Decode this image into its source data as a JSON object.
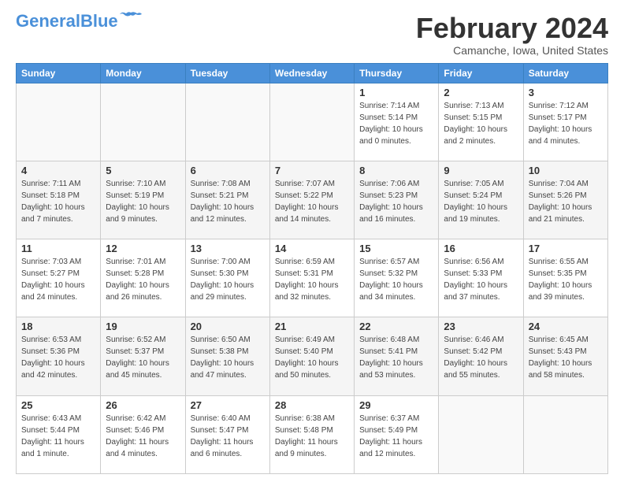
{
  "header": {
    "logo_general": "General",
    "logo_blue": "Blue",
    "month_title": "February 2024",
    "location": "Camanche, Iowa, United States"
  },
  "days_of_week": [
    "Sunday",
    "Monday",
    "Tuesday",
    "Wednesday",
    "Thursday",
    "Friday",
    "Saturday"
  ],
  "weeks": [
    {
      "shaded": false,
      "days": [
        {
          "num": "",
          "info": ""
        },
        {
          "num": "",
          "info": ""
        },
        {
          "num": "",
          "info": ""
        },
        {
          "num": "",
          "info": ""
        },
        {
          "num": "1",
          "info": "Sunrise: 7:14 AM\nSunset: 5:14 PM\nDaylight: 10 hours\nand 0 minutes."
        },
        {
          "num": "2",
          "info": "Sunrise: 7:13 AM\nSunset: 5:15 PM\nDaylight: 10 hours\nand 2 minutes."
        },
        {
          "num": "3",
          "info": "Sunrise: 7:12 AM\nSunset: 5:17 PM\nDaylight: 10 hours\nand 4 minutes."
        }
      ]
    },
    {
      "shaded": true,
      "days": [
        {
          "num": "4",
          "info": "Sunrise: 7:11 AM\nSunset: 5:18 PM\nDaylight: 10 hours\nand 7 minutes."
        },
        {
          "num": "5",
          "info": "Sunrise: 7:10 AM\nSunset: 5:19 PM\nDaylight: 10 hours\nand 9 minutes."
        },
        {
          "num": "6",
          "info": "Sunrise: 7:08 AM\nSunset: 5:21 PM\nDaylight: 10 hours\nand 12 minutes."
        },
        {
          "num": "7",
          "info": "Sunrise: 7:07 AM\nSunset: 5:22 PM\nDaylight: 10 hours\nand 14 minutes."
        },
        {
          "num": "8",
          "info": "Sunrise: 7:06 AM\nSunset: 5:23 PM\nDaylight: 10 hours\nand 16 minutes."
        },
        {
          "num": "9",
          "info": "Sunrise: 7:05 AM\nSunset: 5:24 PM\nDaylight: 10 hours\nand 19 minutes."
        },
        {
          "num": "10",
          "info": "Sunrise: 7:04 AM\nSunset: 5:26 PM\nDaylight: 10 hours\nand 21 minutes."
        }
      ]
    },
    {
      "shaded": false,
      "days": [
        {
          "num": "11",
          "info": "Sunrise: 7:03 AM\nSunset: 5:27 PM\nDaylight: 10 hours\nand 24 minutes."
        },
        {
          "num": "12",
          "info": "Sunrise: 7:01 AM\nSunset: 5:28 PM\nDaylight: 10 hours\nand 26 minutes."
        },
        {
          "num": "13",
          "info": "Sunrise: 7:00 AM\nSunset: 5:30 PM\nDaylight: 10 hours\nand 29 minutes."
        },
        {
          "num": "14",
          "info": "Sunrise: 6:59 AM\nSunset: 5:31 PM\nDaylight: 10 hours\nand 32 minutes."
        },
        {
          "num": "15",
          "info": "Sunrise: 6:57 AM\nSunset: 5:32 PM\nDaylight: 10 hours\nand 34 minutes."
        },
        {
          "num": "16",
          "info": "Sunrise: 6:56 AM\nSunset: 5:33 PM\nDaylight: 10 hours\nand 37 minutes."
        },
        {
          "num": "17",
          "info": "Sunrise: 6:55 AM\nSunset: 5:35 PM\nDaylight: 10 hours\nand 39 minutes."
        }
      ]
    },
    {
      "shaded": true,
      "days": [
        {
          "num": "18",
          "info": "Sunrise: 6:53 AM\nSunset: 5:36 PM\nDaylight: 10 hours\nand 42 minutes."
        },
        {
          "num": "19",
          "info": "Sunrise: 6:52 AM\nSunset: 5:37 PM\nDaylight: 10 hours\nand 45 minutes."
        },
        {
          "num": "20",
          "info": "Sunrise: 6:50 AM\nSunset: 5:38 PM\nDaylight: 10 hours\nand 47 minutes."
        },
        {
          "num": "21",
          "info": "Sunrise: 6:49 AM\nSunset: 5:40 PM\nDaylight: 10 hours\nand 50 minutes."
        },
        {
          "num": "22",
          "info": "Sunrise: 6:48 AM\nSunset: 5:41 PM\nDaylight: 10 hours\nand 53 minutes."
        },
        {
          "num": "23",
          "info": "Sunrise: 6:46 AM\nSunset: 5:42 PM\nDaylight: 10 hours\nand 55 minutes."
        },
        {
          "num": "24",
          "info": "Sunrise: 6:45 AM\nSunset: 5:43 PM\nDaylight: 10 hours\nand 58 minutes."
        }
      ]
    },
    {
      "shaded": false,
      "days": [
        {
          "num": "25",
          "info": "Sunrise: 6:43 AM\nSunset: 5:44 PM\nDaylight: 11 hours\nand 1 minute."
        },
        {
          "num": "26",
          "info": "Sunrise: 6:42 AM\nSunset: 5:46 PM\nDaylight: 11 hours\nand 4 minutes."
        },
        {
          "num": "27",
          "info": "Sunrise: 6:40 AM\nSunset: 5:47 PM\nDaylight: 11 hours\nand 6 minutes."
        },
        {
          "num": "28",
          "info": "Sunrise: 6:38 AM\nSunset: 5:48 PM\nDaylight: 11 hours\nand 9 minutes."
        },
        {
          "num": "29",
          "info": "Sunrise: 6:37 AM\nSunset: 5:49 PM\nDaylight: 11 hours\nand 12 minutes."
        },
        {
          "num": "",
          "info": ""
        },
        {
          "num": "",
          "info": ""
        }
      ]
    }
  ]
}
